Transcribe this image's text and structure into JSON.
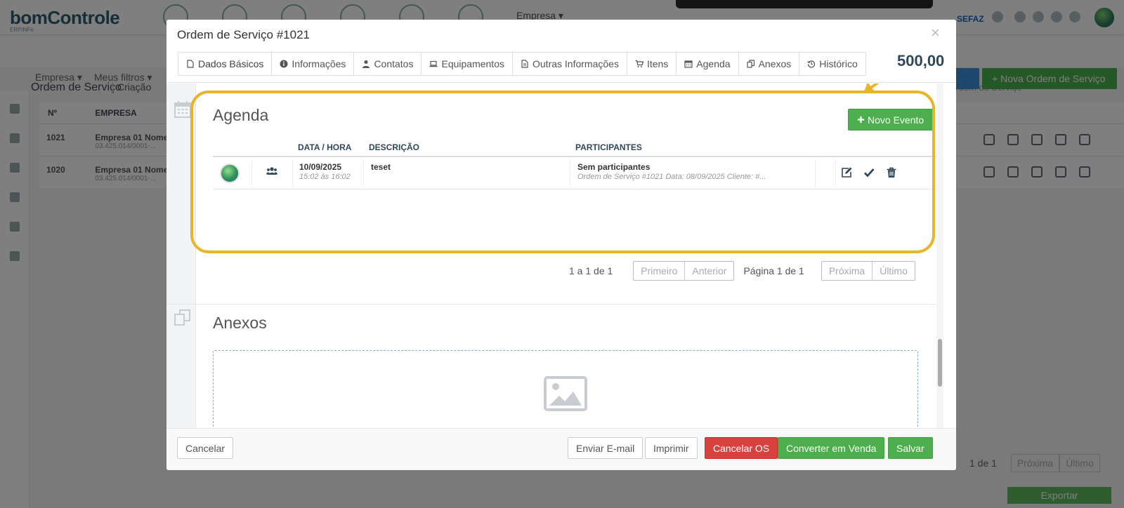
{
  "background": {
    "logo": "bomControle",
    "logo_sub": "ERP/NFe",
    "top_menu": "Empresa",
    "sefaz": "SEFAZ",
    "page_title": "Ordem de Serviço",
    "crumb": "Criação",
    "search_placeholder": "Ordem de Serviço",
    "filters": [
      "Empresa",
      "Meus filtros"
    ],
    "new_button": "Nova Ordem de Serviço",
    "table_headers": [
      "Nº",
      "EMPRESA"
    ],
    "rows": [
      {
        "num": "1021",
        "company": "Empresa 01 Nome",
        "sub": "03.425.014/0001-..."
      },
      {
        "num": "1020",
        "company": "Empresa 01 Nome",
        "sub": "03.425.014/0001-..."
      }
    ],
    "pager_text": "1 de 1",
    "pager_next": "Próxima",
    "pager_last": "Último",
    "export": "Exportar"
  },
  "modal": {
    "title": "Ordem de Serviço #1021",
    "close": "×",
    "total": "500,00",
    "tabs": [
      {
        "label": "Dados Básicos",
        "icon": "file-icon"
      },
      {
        "label": "Informações",
        "icon": "info-icon"
      },
      {
        "label": "Contatos",
        "icon": "user-icon"
      },
      {
        "label": "Equipamentos",
        "icon": "laptop-icon"
      },
      {
        "label": "Outras Informações",
        "icon": "file-text-icon"
      },
      {
        "label": "Itens",
        "icon": "cart-icon"
      },
      {
        "label": "Agenda",
        "icon": "calendar-icon"
      },
      {
        "label": "Anexos",
        "icon": "copy-icon"
      },
      {
        "label": "Histórico",
        "icon": "history-icon"
      }
    ],
    "agenda": {
      "title": "Agenda",
      "new_event": "Novo Evento",
      "headers": {
        "date": "DATA / HORA",
        "desc": "DESCRIÇÃO",
        "participants": "PARTICIPANTES"
      },
      "rows": [
        {
          "date": "10/09/2025",
          "time": "15:02 às 16:02",
          "description": "teset",
          "participants": "Sem participantes",
          "participants_sub": "Ordem de Serviço #1021 Data: 08/09/2025 Cliente: #..."
        }
      ],
      "pager": {
        "summary": "1 a 1 de 1",
        "first": "Primeiro",
        "prev": "Anterior",
        "page": "Página 1 de 1",
        "next": "Próxima",
        "last": "Último"
      }
    },
    "anexos": {
      "title": "Anexos"
    },
    "footer": {
      "cancel": "Cancelar",
      "email": "Enviar E-mail",
      "print": "Imprimir",
      "cancel_os": "Cancelar OS",
      "convert": "Converter em Venda",
      "save": "Salvar"
    },
    "colors": {
      "green": "#4cae4c",
      "red": "#d9413e",
      "highlight": "#e8b52a"
    }
  }
}
